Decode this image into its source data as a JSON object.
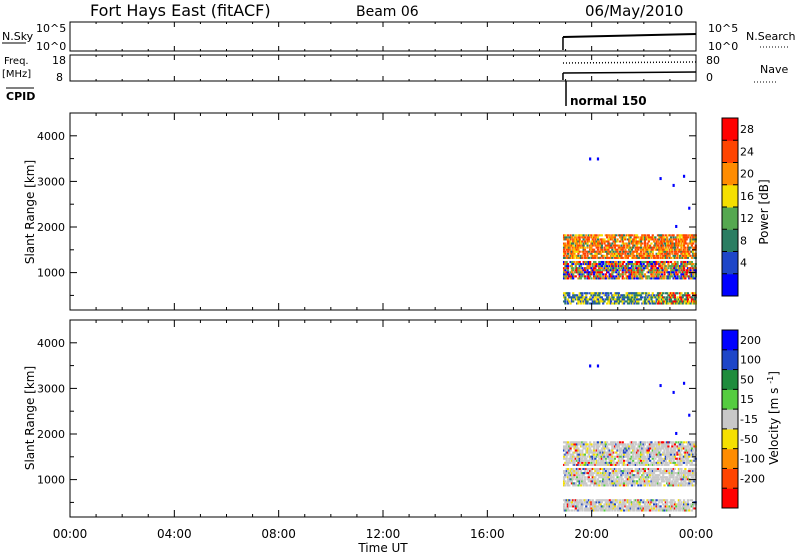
{
  "header": {
    "station": "Fort Hays East (fitACF)",
    "beam": "Beam 06",
    "date": "06/May/2010"
  },
  "param_panel": {
    "nsky_label": "N.Sky",
    "nsky_ticks": [
      "10^5",
      "10^0"
    ],
    "nsearch_label": "N.Search",
    "nsearch_ticks": [
      "10^5",
      "10^0"
    ],
    "freq_label": "Freq.",
    "freq_unit": "[MHz]",
    "freq_ticks": [
      "18",
      "8"
    ],
    "nave_label": "Nave",
    "nave_ticks": [
      "80",
      "0"
    ],
    "cpid_label": "CPID",
    "cpid_value": "normal 150"
  },
  "xaxis": {
    "label": "Time UT",
    "ticks": [
      "00:00",
      "04:00",
      "08:00",
      "12:00",
      "16:00",
      "20:00",
      "00:00"
    ],
    "range_hours": [
      0,
      24
    ]
  },
  "chart_data": [
    {
      "type": "heatmap",
      "title": "",
      "xlabel": "Time UT",
      "ylabel": "Slant Range [km]",
      "yticks": [
        "4000",
        "3000",
        "2000",
        "1000"
      ],
      "ylim": [
        180,
        4500
      ],
      "colorbar": {
        "label": "Power [dB]",
        "ticks": [
          "28",
          "24",
          "20",
          "16",
          "12",
          "8",
          "4"
        ],
        "colors": [
          "#0000ff",
          "#1e46c8",
          "#2a7d62",
          "#55a850",
          "#f5e000",
          "#ff8c00",
          "#ff4400",
          "#ff0000"
        ]
      },
      "data_start_hour": 18.9,
      "scatter_bands_km": [
        [
          300,
          550
        ],
        [
          850,
          1250
        ],
        [
          1300,
          1800
        ]
      ]
    },
    {
      "type": "heatmap",
      "title": "",
      "xlabel": "Time UT",
      "ylabel": "Slant Range [km]",
      "yticks": [
        "4000",
        "3000",
        "2000",
        "1000"
      ],
      "ylim": [
        180,
        4500
      ],
      "colorbar": {
        "label": "Velocity [m s^-1]",
        "ticks": [
          "200",
          "100",
          "50",
          "15",
          "-15",
          "-50",
          "-100",
          "-200"
        ],
        "colors": [
          "#ff0000",
          "#ff4400",
          "#ff8c00",
          "#f5e000",
          "#c8c8c8",
          "#55cc40",
          "#1e8c3c",
          "#1e46c8",
          "#0000ff"
        ]
      },
      "data_start_hour": 18.9,
      "scatter_bands_km": [
        [
          300,
          550
        ],
        [
          850,
          1250
        ],
        [
          1300,
          1800
        ]
      ]
    }
  ]
}
